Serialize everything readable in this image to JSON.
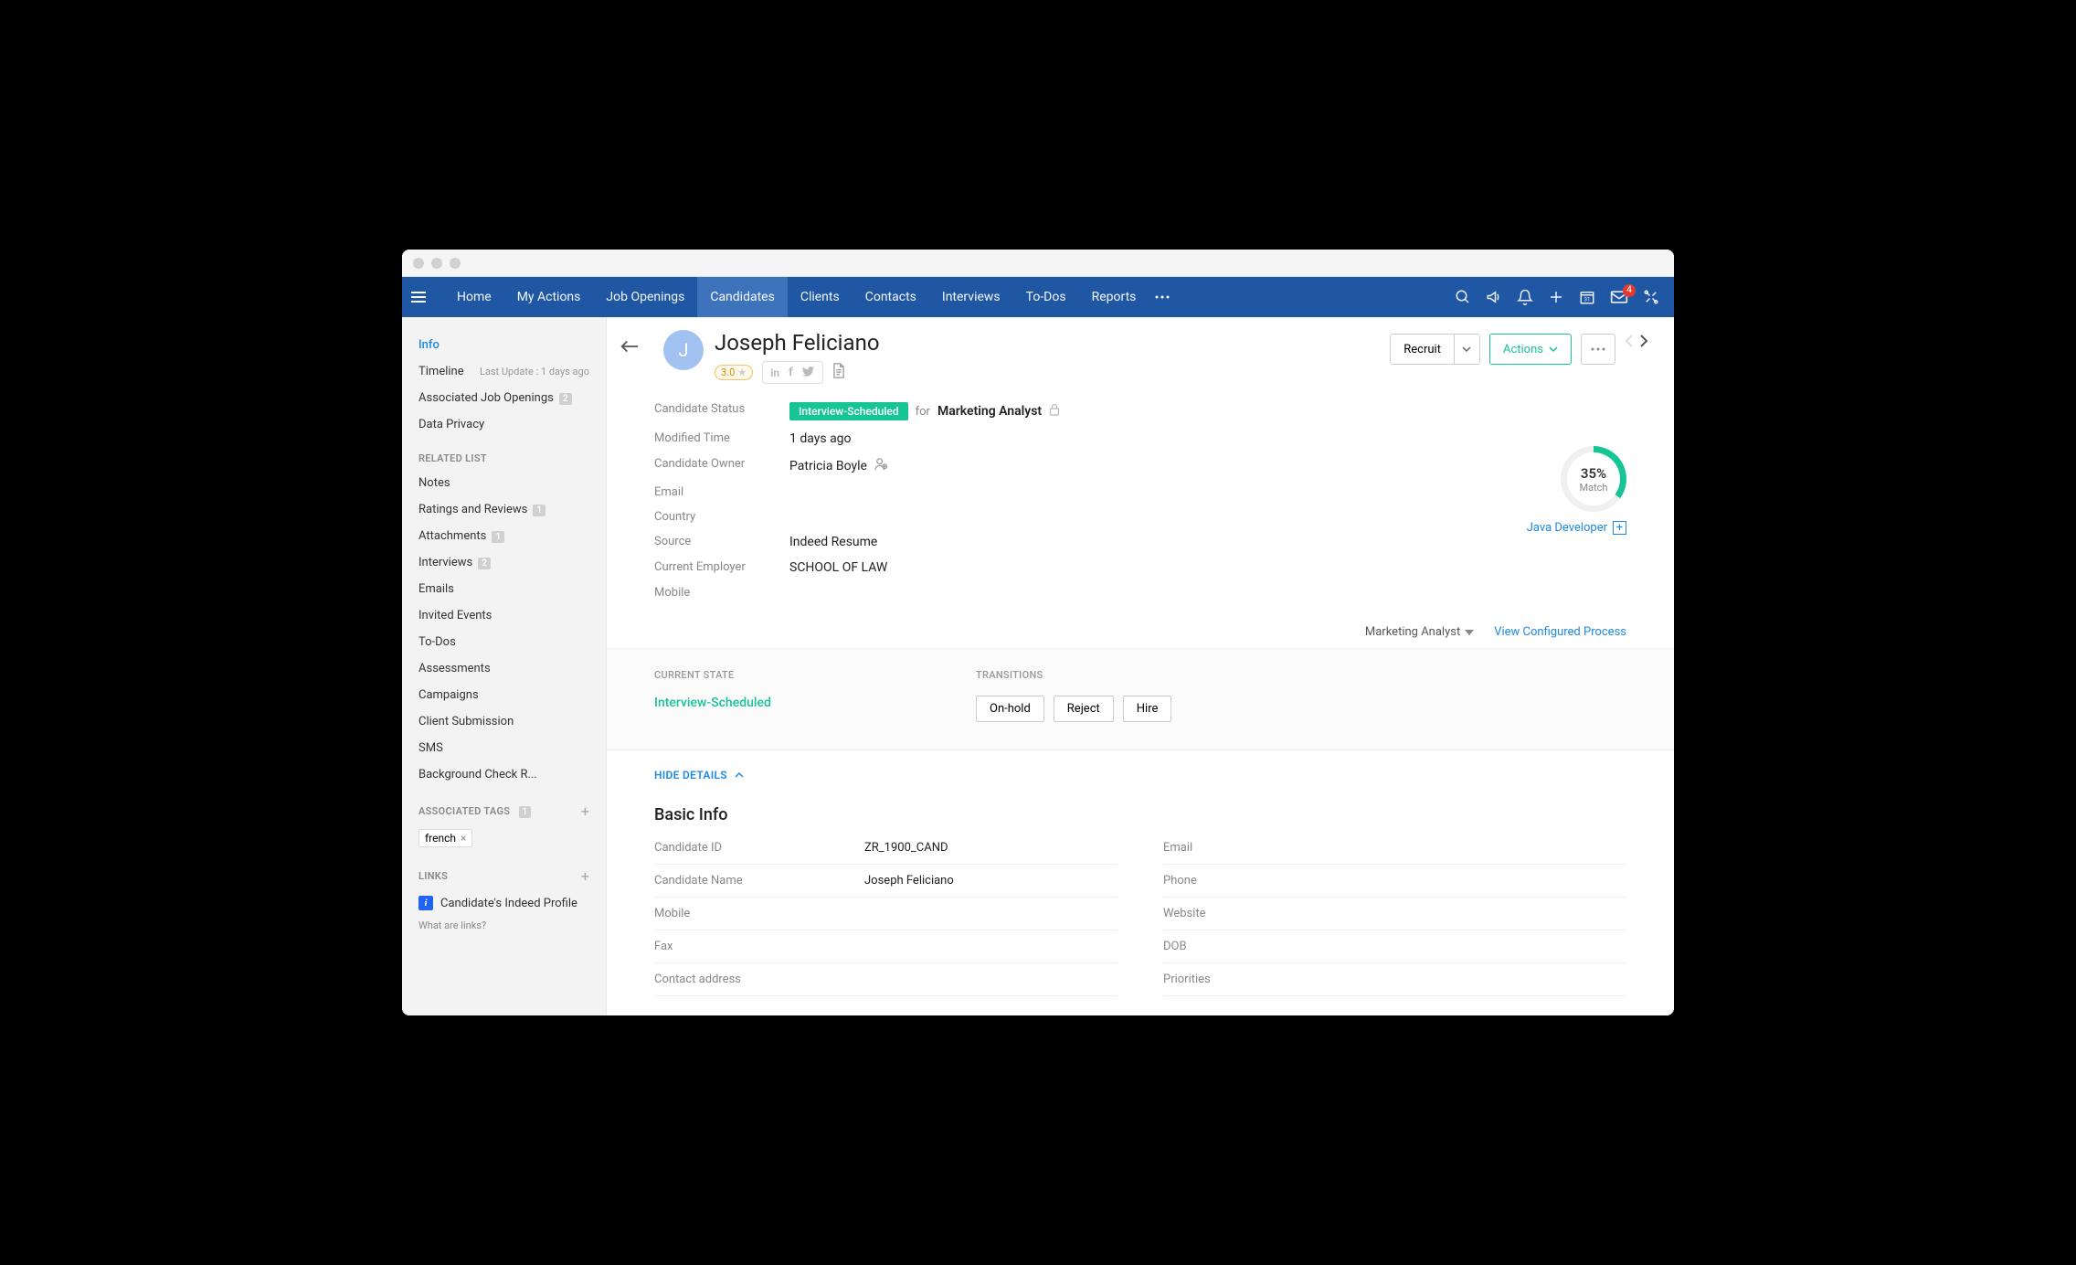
{
  "nav": {
    "items": [
      "Home",
      "My Actions",
      "Job Openings",
      "Candidates",
      "Clients",
      "Contacts",
      "Interviews",
      "To-Dos",
      "Reports"
    ],
    "active_index": 3,
    "mail_badge": "4"
  },
  "sidebar": {
    "primary": [
      {
        "label": "Info",
        "active": true
      },
      {
        "label": "Timeline",
        "sub": "Last Update : 1 days ago"
      },
      {
        "label": "Associated Job Openings",
        "badge": "2"
      },
      {
        "label": "Data Privacy"
      }
    ],
    "related_heading": "RELATED LIST",
    "related": [
      {
        "label": "Notes"
      },
      {
        "label": "Ratings and Reviews",
        "badge": "1"
      },
      {
        "label": "Attachments",
        "badge": "1"
      },
      {
        "label": "Interviews",
        "badge": "2"
      },
      {
        "label": "Emails"
      },
      {
        "label": "Invited Events"
      },
      {
        "label": "To-Dos"
      },
      {
        "label": "Assessments"
      },
      {
        "label": "Campaigns"
      },
      {
        "label": "Client Submission"
      },
      {
        "label": "SMS"
      },
      {
        "label": "Background Check R..."
      }
    ],
    "tags_heading": "ASSOCIATED TAGS",
    "tags_badge": "1",
    "tags": [
      "french"
    ],
    "links_heading": "LINKS",
    "links": [
      "Candidate's Indeed Profile"
    ],
    "what_links": "What are links?"
  },
  "header": {
    "avatar_letter": "J",
    "name": "Joseph Feliciano",
    "rating": "3.0",
    "recruit_label": "Recruit",
    "actions_label": "Actions"
  },
  "summary": {
    "rows": [
      {
        "label": "Candidate Status"
      },
      {
        "label": "Modified Time",
        "value": "1 days ago"
      },
      {
        "label": "Candidate Owner",
        "value": "Patricia Boyle",
        "owner": true
      },
      {
        "label": "Email",
        "value": ""
      },
      {
        "label": "Country",
        "value": ""
      },
      {
        "label": "Source",
        "value": "Indeed Resume"
      },
      {
        "label": "Current Employer",
        "value": "SCHOOL OF LAW"
      },
      {
        "label": "Mobile",
        "value": ""
      }
    ],
    "status_badge": "Interview-Scheduled",
    "status_for": "for",
    "status_job": "Marketing Analyst"
  },
  "match": {
    "pct": "35%",
    "label": "Match",
    "job": "Java Developer"
  },
  "process": {
    "dropdown": "Marketing Analyst",
    "link": "View Configured Process"
  },
  "state": {
    "current_hd": "CURRENT STATE",
    "current_val": "Interview-Scheduled",
    "trans_hd": "TRANSITIONS",
    "trans_btns": [
      "On-hold",
      "Reject",
      "Hire"
    ]
  },
  "hide_details": "HIDE DETAILS",
  "basic": {
    "heading": "Basic Info",
    "left": [
      {
        "label": "Candidate ID",
        "value": "ZR_1900_CAND"
      },
      {
        "label": "Candidate Name",
        "value": "Joseph Feliciano"
      },
      {
        "label": "Mobile",
        "value": ""
      },
      {
        "label": "Fax",
        "value": ""
      },
      {
        "label": "Contact address",
        "value": ""
      }
    ],
    "right": [
      {
        "label": "Email",
        "value": ""
      },
      {
        "label": "Phone",
        "value": ""
      },
      {
        "label": "Website",
        "value": ""
      },
      {
        "label": "DOB",
        "value": ""
      },
      {
        "label": "Priorities",
        "value": ""
      }
    ]
  }
}
